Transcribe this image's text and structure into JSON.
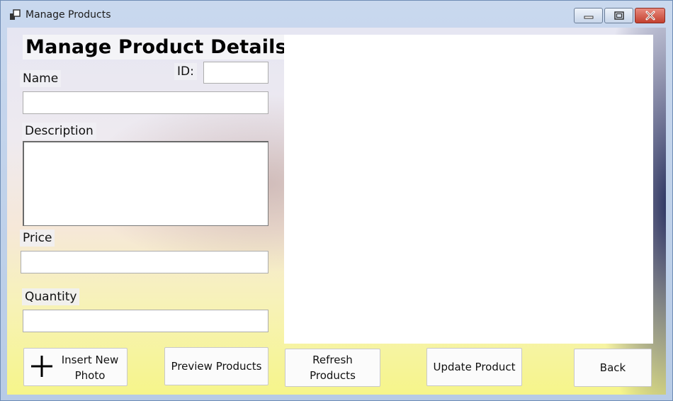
{
  "window": {
    "title": "Manage Products",
    "colors": {
      "close_button": "#c3402f",
      "frame": "#b7cbe6"
    }
  },
  "form": {
    "heading": "Manage Product Details",
    "id_label": "ID:",
    "id_value": "",
    "name_label": "Name",
    "name_value": "",
    "description_label": "Description",
    "description_value": "",
    "price_label": "Price",
    "price_value": "",
    "quantity_label": "Quantity",
    "quantity_value": ""
  },
  "buttons": {
    "insert_photo_line1": "Insert New",
    "insert_photo_line2": "Photo",
    "preview": "Preview Products",
    "refresh_line1": "Refresh",
    "refresh_line2": "Products",
    "update": "Update Product",
    "back": "Back"
  },
  "icons": {
    "app": "app-icon",
    "minimize": "minimize-icon",
    "maximize": "maximize-icon",
    "close": "close-icon",
    "plus": "plus-icon"
  }
}
